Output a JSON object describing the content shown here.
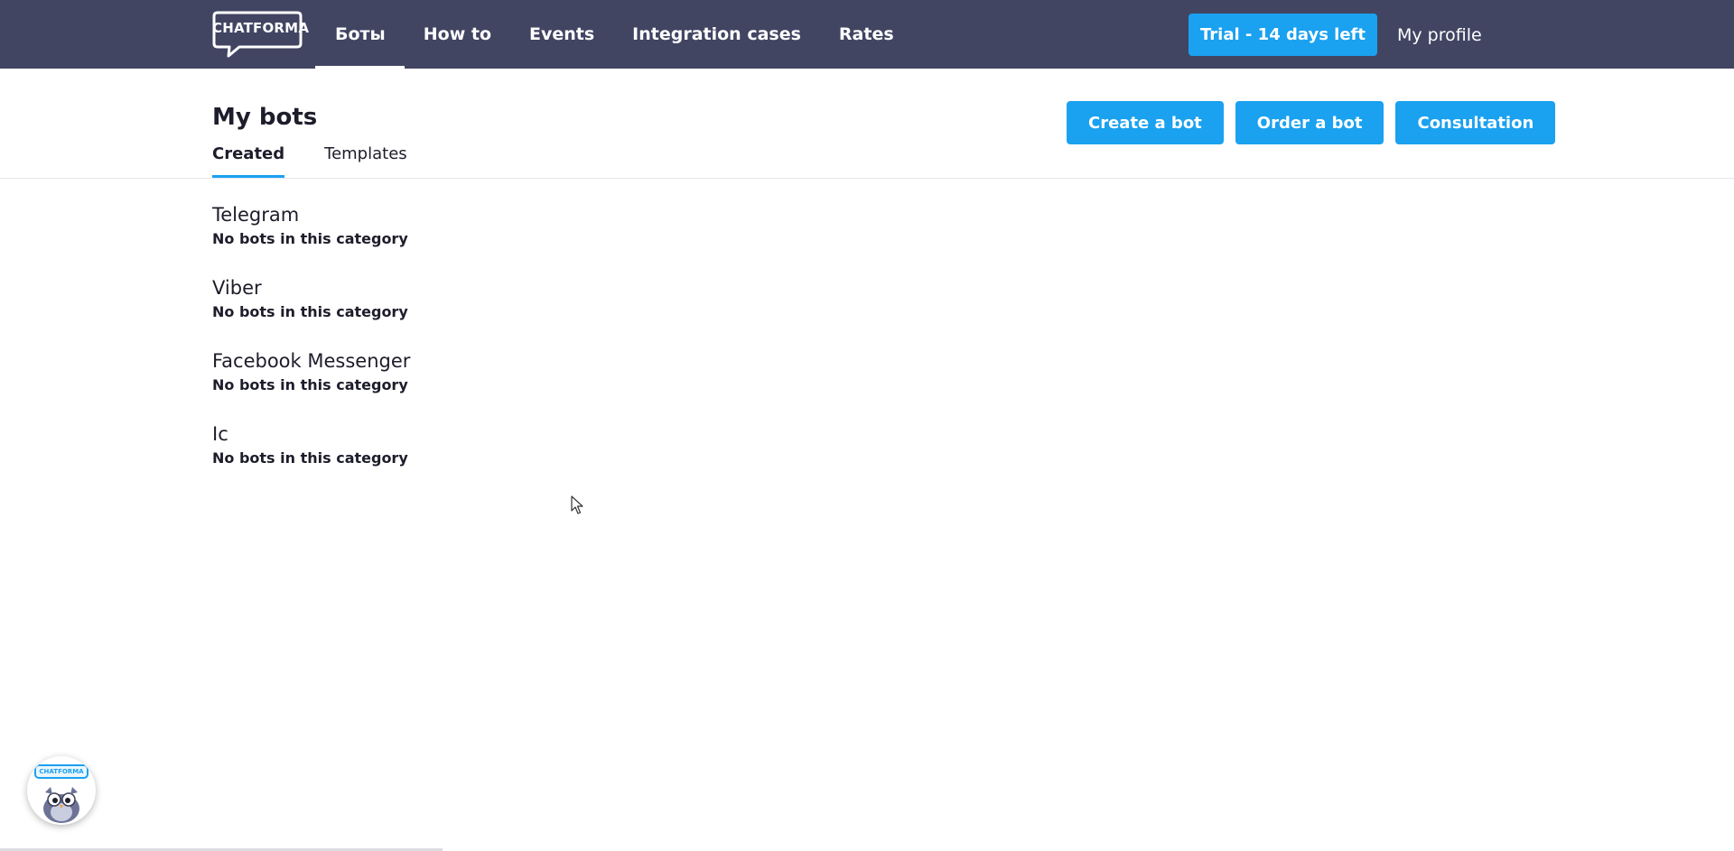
{
  "brand": {
    "logo_text": "CHATFORMA"
  },
  "nav": {
    "items": [
      {
        "label": "Боты",
        "active": true
      },
      {
        "label": "How to",
        "active": false
      },
      {
        "label": "Events",
        "active": false
      },
      {
        "label": "Integration cases",
        "active": false
      },
      {
        "label": "Rates",
        "active": false
      }
    ],
    "trial_label": "Trial - 14 days left",
    "profile_label": "My profile"
  },
  "page": {
    "title": "My bots",
    "tabs": [
      {
        "label": "Created",
        "active": true
      },
      {
        "label": "Templates",
        "active": false
      }
    ],
    "actions": {
      "create_label": "Create a bot",
      "order_label": "Order a bot",
      "consultation_label": "Consultation"
    }
  },
  "categories": [
    {
      "name": "Telegram",
      "empty_text": "No bots in this category"
    },
    {
      "name": "Viber",
      "empty_text": "No bots in this category"
    },
    {
      "name": "Facebook Messenger",
      "empty_text": "No bots in this category"
    },
    {
      "name": "Ic",
      "empty_text": "No bots in this category"
    }
  ],
  "widget": {
    "label": "CHATFORMA",
    "icon": "owl-mascot-icon"
  },
  "colors": {
    "topbar": "#414562",
    "accent": "#1aa1f0",
    "text": "#1d1d2b",
    "divider": "#e4e6ec"
  }
}
